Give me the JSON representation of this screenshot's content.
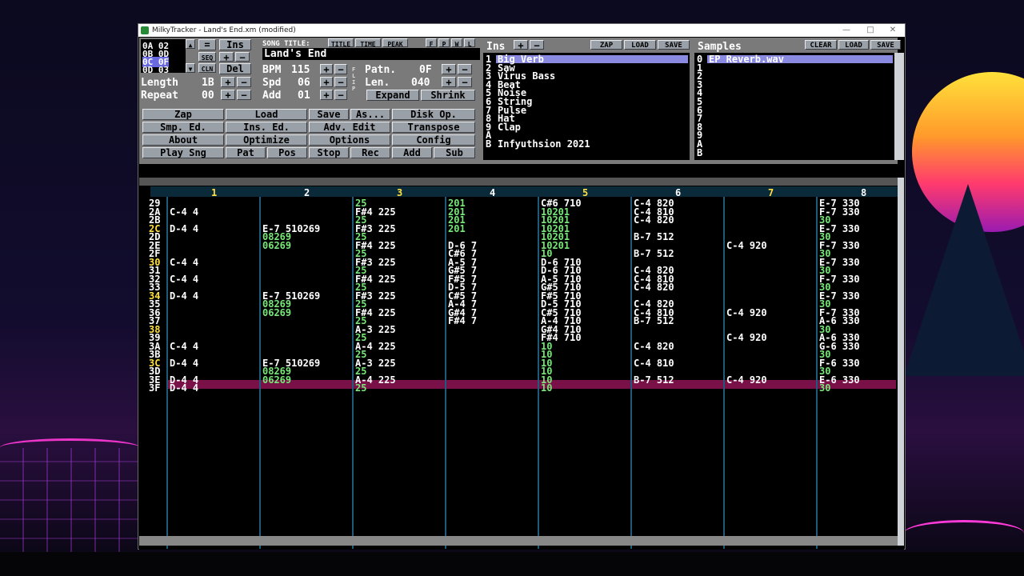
{
  "window": {
    "title": "MilkyTracker - Land's End.xm (modified)",
    "controls": [
      "—",
      "□",
      "✕"
    ]
  },
  "orderlist": {
    "entries": [
      "0A 02",
      "0B 0D",
      "0C 0F",
      "0D 03"
    ],
    "selected_index": 2,
    "ins_label": "Ins",
    "del_label": "Del",
    "seq_label": "SEQ",
    "cln_label": "CLN",
    "eq_label": "=",
    "length_label": "Length",
    "length_value": "1B",
    "repeat_label": "Repeat",
    "repeat_value": "00"
  },
  "song": {
    "title_label": "SONG TITLE:",
    "tab_title": "TITLE",
    "tab_time": "TIME",
    "tab_peak": "PEAK",
    "title_value": "Land's End",
    "bpm_label": "BPM",
    "bpm_value": "115",
    "spd_label": "Spd",
    "spd_value": "06",
    "add_label": "Add",
    "add_value": "01",
    "patn_label": "Patn.",
    "patn_value": "0F",
    "len_label": "Len.",
    "len_value": "040",
    "expand_label": "Expand",
    "shrink_label": "Shrink",
    "flip_label": "FLIP"
  },
  "toolbar": {
    "rows": [
      [
        "Zap",
        "Load",
        "Save",
        "As...",
        "Disk Op."
      ],
      [
        "Smp. Ed.",
        "Ins. Ed.",
        "Adv. Edit",
        "Transpose"
      ],
      [
        "About",
        "Optimize",
        "Options",
        "Config"
      ],
      [
        "Play Sng",
        "Pat",
        "Pos",
        "Stop",
        "Rec",
        "Add",
        "Sub"
      ]
    ]
  },
  "instruments": {
    "header": "Ins",
    "zap_label": "ZAP",
    "load_label": "LOAD",
    "save_label": "SAVE",
    "items": [
      {
        "num": "1",
        "name": "Big Verb"
      },
      {
        "num": "2",
        "name": "Saw"
      },
      {
        "num": "3",
        "name": "Virus Bass"
      },
      {
        "num": "4",
        "name": "Beat"
      },
      {
        "num": "5",
        "name": "Noise"
      },
      {
        "num": "6",
        "name": "String"
      },
      {
        "num": "7",
        "name": "Pulse"
      },
      {
        "num": "8",
        "name": "Hat"
      },
      {
        "num": "9",
        "name": "Clap"
      },
      {
        "num": "A",
        "name": ""
      },
      {
        "num": "B",
        "name": "Infyuthsion 2021"
      }
    ]
  },
  "samples": {
    "header": "Samples",
    "clear_label": "CLEAR",
    "load_label": "LOAD",
    "save_label": "SAVE",
    "items": [
      {
        "num": "0",
        "name": "EP Reverb.wav"
      },
      {
        "num": "1",
        "name": ""
      },
      {
        "num": "2",
        "name": ""
      },
      {
        "num": "3",
        "name": ""
      },
      {
        "num": "4",
        "name": ""
      },
      {
        "num": "5",
        "name": ""
      },
      {
        "num": "6",
        "name": ""
      },
      {
        "num": "7",
        "name": ""
      },
      {
        "num": "8",
        "name": ""
      },
      {
        "num": "9",
        "name": ""
      },
      {
        "num": "A",
        "name": ""
      },
      {
        "num": "B",
        "name": ""
      }
    ]
  },
  "pattern": {
    "channels": [
      "1",
      "2",
      "3",
      "4",
      "5",
      "6",
      "7",
      "8"
    ],
    "current_row": "3D",
    "rows": [
      {
        "n": "29",
        "c": [
          "",
          "",
          "25",
          "201",
          "C#6 710",
          "C-4 820",
          "",
          "E-7 330"
        ]
      },
      {
        "n": "2A",
        "c": [
          "C-4 4",
          "",
          "F#4 225",
          "201",
          "10201",
          "C-4 810",
          "",
          "F-7 330"
        ]
      },
      {
        "n": "2B",
        "c": [
          "",
          "",
          "25",
          "201",
          "10201",
          "C-4 820",
          "",
          "30"
        ]
      },
      {
        "n": "2C",
        "c": [
          "D-4 4",
          "E-7 510269",
          "F#3 225",
          "201",
          "10201",
          "",
          "",
          "E-7 330"
        ]
      },
      {
        "n": "2D",
        "c": [
          "",
          "08269",
          "25",
          "",
          "10201",
          "B-7 512",
          "",
          "30"
        ]
      },
      {
        "n": "2E",
        "c": [
          "",
          "06269",
          "F#4 225",
          "D-6 7",
          "10201",
          "",
          "C-4 920",
          "F-7 330"
        ]
      },
      {
        "n": "2F",
        "c": [
          "",
          "",
          "25",
          "C#6 7",
          "10",
          "B-7 512",
          "",
          "30"
        ]
      },
      {
        "n": "30",
        "c": [
          "C-4 4",
          "",
          "F#3 225",
          "A-5 7",
          "D-6 710",
          "",
          "",
          "E-7 330"
        ]
      },
      {
        "n": "31",
        "c": [
          "",
          "",
          "25",
          "G#5 7",
          "D-6 710",
          "C-4 820",
          "",
          "30"
        ]
      },
      {
        "n": "32",
        "c": [
          "C-4 4",
          "",
          "F#4 225",
          "F#5 7",
          "A-5 710",
          "C-4 810",
          "",
          "F-7 330"
        ]
      },
      {
        "n": "33",
        "c": [
          "",
          "",
          "25",
          "D-5 7",
          "G#5 710",
          "C-4 820",
          "",
          "30"
        ]
      },
      {
        "n": "34",
        "c": [
          "D-4 4",
          "E-7 510269",
          "F#3 225",
          "C#5 7",
          "F#5 710",
          "",
          "",
          "E-7 330"
        ]
      },
      {
        "n": "35",
        "c": [
          "",
          "08269",
          "25",
          "A-4 7",
          "D-5 710",
          "C-4 820",
          "",
          "30"
        ]
      },
      {
        "n": "36",
        "c": [
          "",
          "06269",
          "F#4 225",
          "G#4 7",
          "C#5 710",
          "C-4 810",
          "C-4 920",
          "F-7 330"
        ]
      },
      {
        "n": "37",
        "c": [
          "",
          "",
          "25",
          "F#4 7",
          "A-4 710",
          "B-7 512",
          "",
          "A-6 330"
        ]
      },
      {
        "n": "38",
        "c": [
          "",
          "",
          "A-3 225",
          "",
          "G#4 710",
          "",
          "",
          "30"
        ]
      },
      {
        "n": "39",
        "c": [
          "",
          "",
          "25",
          "",
          "F#4 710",
          "",
          "C-4 920",
          "A-6 330"
        ]
      },
      {
        "n": "3A",
        "c": [
          "C-4 4",
          "",
          "A-4 225",
          "",
          "10",
          "C-4 820",
          "",
          "G-6 330"
        ]
      },
      {
        "n": "3B",
        "c": [
          "",
          "",
          "25",
          "",
          "10",
          "",
          "",
          "30"
        ]
      },
      {
        "n": "3C",
        "c": [
          "D-4 4",
          "E-7 510269",
          "A-3 225",
          "",
          "10",
          "C-4 810",
          "",
          "F-6 330"
        ]
      },
      {
        "n": "3D",
        "c": [
          "",
          "08269",
          "25",
          "",
          "10",
          "",
          "",
          "30"
        ]
      },
      {
        "n": "3E",
        "c": [
          "D-4 4",
          "06269",
          "A-4 225",
          "",
          "10",
          "B-7 512",
          "C-4 920",
          "E-6 330"
        ]
      },
      {
        "n": "3F",
        "c": [
          "D-4 4",
          "",
          "25",
          "",
          "10",
          "",
          "",
          "30"
        ]
      }
    ]
  },
  "colors": {
    "highlight_row": "#7a1048",
    "selected_list": "#8a8ae0",
    "row_number_yellow": "#ffe040"
  }
}
